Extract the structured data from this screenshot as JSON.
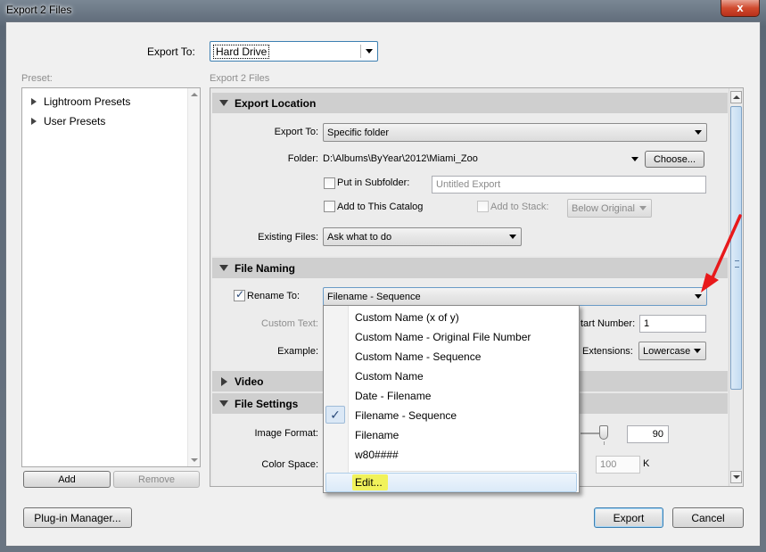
{
  "window": {
    "title": "Export 2 Files",
    "close_glyph": "x"
  },
  "export_to": {
    "label": "Export To:",
    "value": "Hard Drive"
  },
  "preset": {
    "label": "Preset:",
    "items": [
      {
        "label": "Lightroom Presets"
      },
      {
        "label": "User Presets"
      }
    ],
    "add_label": "Add",
    "remove_label": "Remove"
  },
  "main": {
    "heading": "Export 2 Files",
    "export_location": {
      "title": "Export Location",
      "export_to_label": "Export To:",
      "export_to_value": "Specific folder",
      "folder_label": "Folder:",
      "folder_path": "D:\\Albums\\ByYear\\2012\\Miami_Zoo",
      "choose_label": "Choose...",
      "subfolder_label": "Put in Subfolder:",
      "subfolder_placeholder": "Untitled Export",
      "add_catalog_label": "Add to This Catalog",
      "add_stack_label": "Add to Stack:",
      "stack_value": "Below Original",
      "existing_files_label": "Existing Files:",
      "existing_files_value": "Ask what to do"
    },
    "file_naming": {
      "title": "File Naming",
      "rename_label": "Rename To:",
      "rename_value": "Filename - Sequence",
      "custom_text_label": "Custom Text:",
      "start_number_label": "tart Number:",
      "start_number_value": "1",
      "example_label": "Example:",
      "extensions_label": "Extensions:",
      "extensions_value": "Lowercase"
    },
    "video": {
      "title": "Video"
    },
    "file_settings": {
      "title": "File Settings",
      "image_format_label": "Image Format:",
      "quality_value": "90",
      "color_space_label": "Color Space:",
      "limit_value": "100",
      "limit_unit": "K"
    }
  },
  "rename_dropdown": {
    "options": [
      {
        "label": "Custom Name (x of y)"
      },
      {
        "label": "Custom Name - Original File Number"
      },
      {
        "label": "Custom Name - Sequence"
      },
      {
        "label": "Custom Name"
      },
      {
        "label": "Date - Filename"
      },
      {
        "label": "Filename - Sequence"
      },
      {
        "label": "Filename"
      },
      {
        "label": "w80####"
      }
    ],
    "selected_index": 5,
    "check_glyph": "✓",
    "edit_label": "Edit..."
  },
  "footer": {
    "plugin_manager_label": "Plug-in Manager...",
    "export_label": "Export",
    "cancel_label": "Cancel"
  },
  "colors": {
    "annotation_arrow": "#e8191b",
    "edit_highlight": "#f1f25a"
  }
}
